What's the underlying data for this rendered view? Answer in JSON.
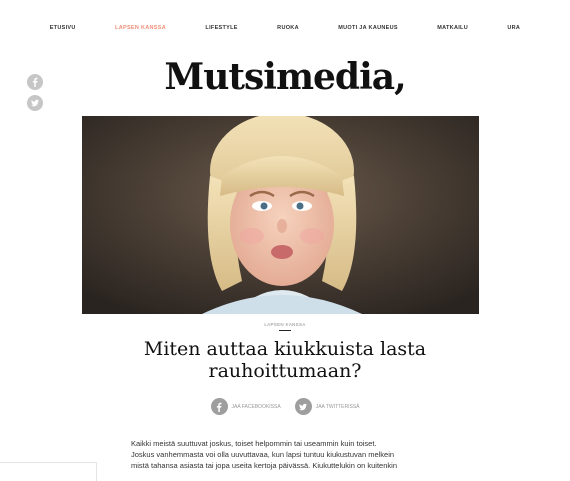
{
  "nav": {
    "items": [
      {
        "label": "ETUSIVU",
        "active": false
      },
      {
        "label": "LAPSEN KANSSA",
        "active": true
      },
      {
        "label": "LIFESTYLE",
        "active": false
      },
      {
        "label": "RUOKA",
        "active": false
      },
      {
        "label": "MUOTI JA KAUNEUS",
        "active": false
      },
      {
        "label": "MATKAILU",
        "active": false
      },
      {
        "label": "URA",
        "active": false
      }
    ]
  },
  "logo": "Mutsimedia,",
  "sidebar_share": {
    "icons": [
      "facebook-icon",
      "twitter-icon"
    ]
  },
  "hero": {
    "image": "angry-child-photo"
  },
  "article": {
    "category": "LAPSEN KANSSA",
    "title": "Miten auttaa kiukkuista lasta rauhoittumaan?",
    "share_facebook": "JAA FACEBOOKISSA",
    "share_twitter": "JAA TWITTERISSÄ",
    "body_lines": [
      "Kaikki meistä suuttuvat joskus, toiset helpommin tai useammin kuin toiset.",
      "Joskus vanhemmasta voi olla uuvuttavaa, kun lapsi tuntuu kiukustuvan melkein",
      "mistä tahansa asiasta tai jopa useita kertoja päivässä. Kiukuttelukin on kuitenkin"
    ]
  },
  "colors": {
    "accent": "#f08f78",
    "icon_gray": "#c6c6c6"
  }
}
